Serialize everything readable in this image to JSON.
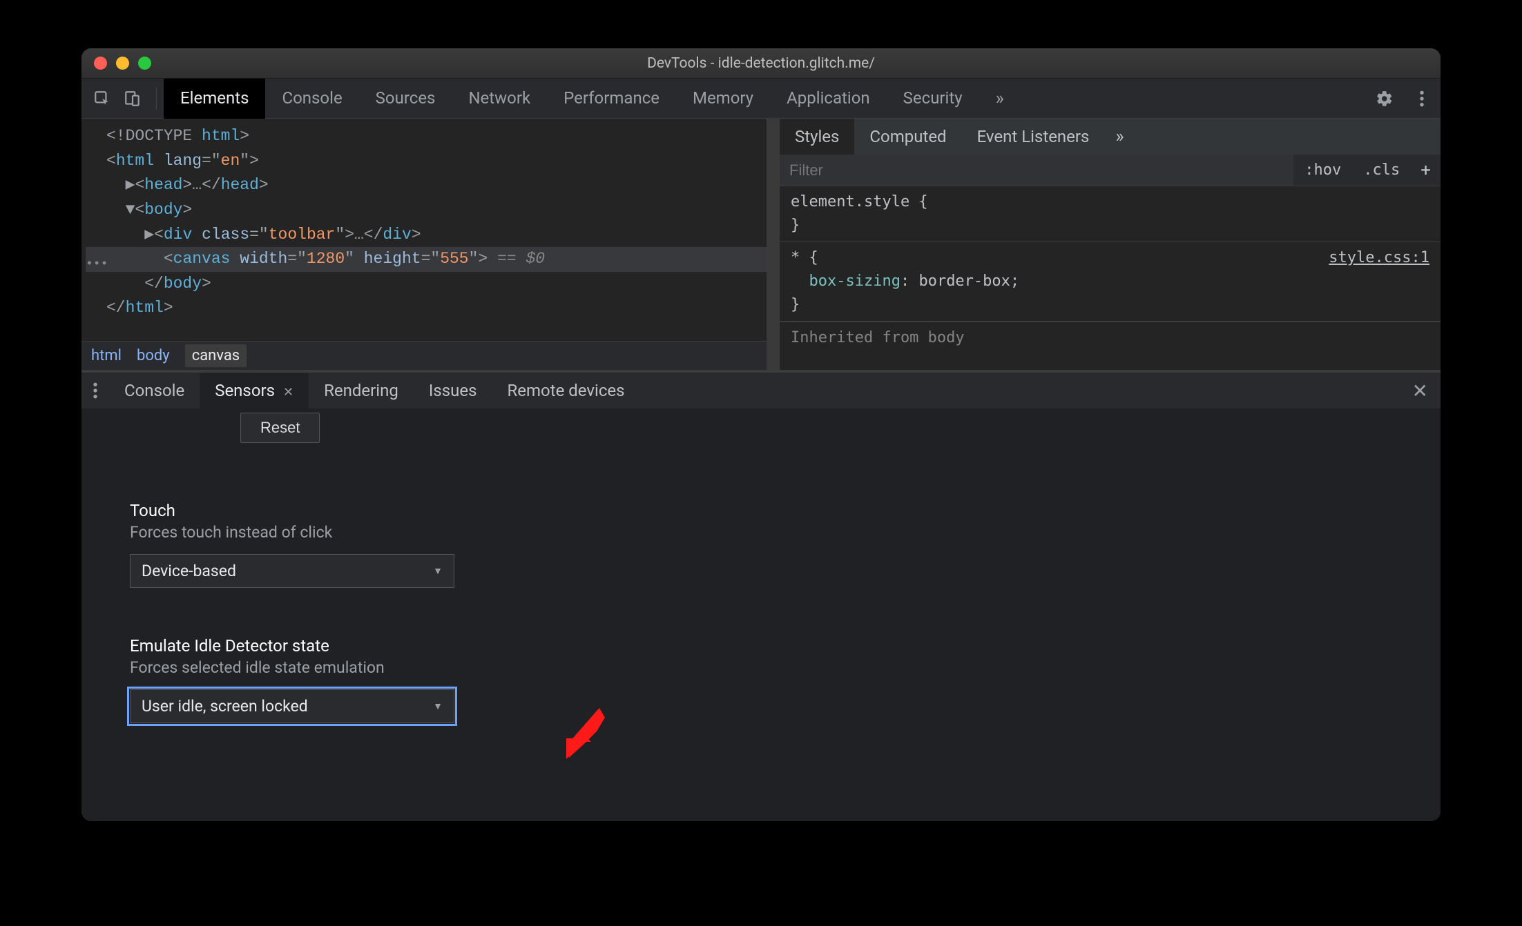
{
  "window": {
    "title": "DevTools - idle-detection.glitch.me/"
  },
  "toolbar": {
    "tabs": [
      "Elements",
      "Console",
      "Sources",
      "Network",
      "Performance",
      "Memory",
      "Application",
      "Security"
    ],
    "active_index": 0,
    "overflow_glyph": "»"
  },
  "dom": {
    "lines": [
      "<!DOCTYPE html>",
      "<html lang=\"en\">",
      "  ▶<head>…</head>",
      "  ▼<body>",
      "    ▶<div class=\"toolbar\">…</div>",
      "      <canvas width=\"1280\" height=\"555\"> == $0",
      "    </body>",
      "</html>"
    ],
    "highlight_index": 5
  },
  "breadcrumb": {
    "items": [
      "html",
      "body",
      "canvas"
    ],
    "active_index": 2
  },
  "styles": {
    "tabs": [
      "Styles",
      "Computed",
      "Event Listeners"
    ],
    "active_index": 0,
    "overflow_glyph": "»",
    "filter_placeholder": "Filter",
    "hov_label": ":hov",
    "cls_label": ".cls",
    "rules": [
      {
        "selector": "element.style",
        "props": []
      },
      {
        "selector": "*",
        "source": "style.css:1",
        "props": [
          [
            "box-sizing",
            "border-box"
          ]
        ]
      }
    ],
    "inherited_label": "Inherited from body"
  },
  "drawer": {
    "tabs": [
      "Console",
      "Sensors",
      "Rendering",
      "Issues",
      "Remote devices"
    ],
    "active_index": 1,
    "active_closeable": true
  },
  "sensors": {
    "reset_label": "Reset",
    "touch": {
      "title": "Touch",
      "desc": "Forces touch instead of click",
      "value": "Device-based"
    },
    "idle": {
      "title": "Emulate Idle Detector state",
      "desc": "Forces selected idle state emulation",
      "value": "User idle, screen locked"
    }
  }
}
